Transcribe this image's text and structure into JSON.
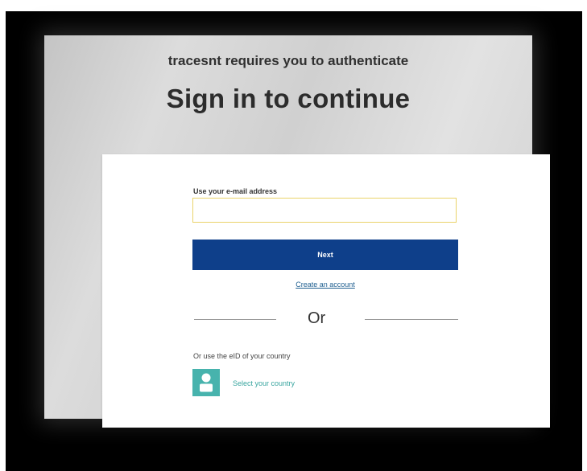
{
  "auth_header": {
    "subtitle": "tracesnt requires you to authenticate",
    "title": "Sign in to continue"
  },
  "login_form": {
    "email_label": "Use your e-mail address",
    "email_value": "",
    "next_button_label": "Next",
    "create_account_link": "Create an account",
    "divider_text": "Or"
  },
  "eid": {
    "prompt": "Or use the eID of your country",
    "icon": "person-icon",
    "select_country_link": "Select your country"
  },
  "colors": {
    "primary_button": "#0e3f8a",
    "eid_accent": "#47b3ad",
    "link": "#1f5f90",
    "input_border": "#ead36a"
  }
}
